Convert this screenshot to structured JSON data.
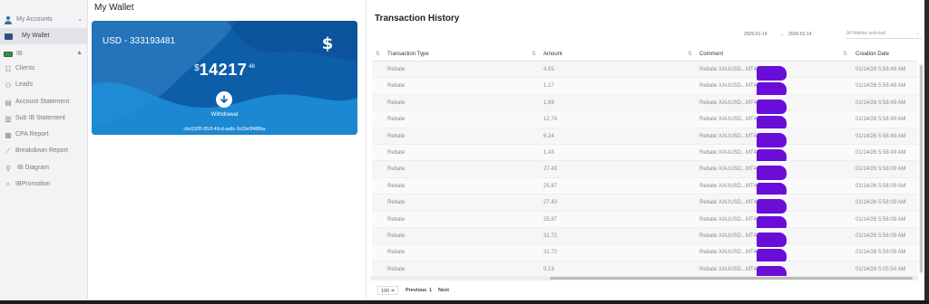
{
  "sidebar": {
    "items": [
      {
        "label": "My Accounts",
        "icon": "user-icon",
        "chev": "⌄"
      },
      {
        "label": "My Wallet",
        "icon": "wallet-icon"
      },
      {
        "label": "IB",
        "icon": "money-icon",
        "chev": "▲"
      },
      {
        "label": "Clients",
        "icon": "clients-icon"
      },
      {
        "label": "Leads",
        "icon": "leads-icon"
      },
      {
        "label": "Account Statement",
        "icon": "statement-icon"
      },
      {
        "label": "Sub IB Statement",
        "icon": "sub-ib-icon"
      },
      {
        "label": "CPA Report",
        "icon": "cpa-icon"
      },
      {
        "label": "Breakdown Report",
        "icon": "chart-icon"
      },
      {
        "label": "IB Diagram",
        "icon": "diagram-icon"
      },
      {
        "label": "IBPromotion",
        "icon": "promotion-icon"
      }
    ]
  },
  "main": {
    "title": "My Wallet"
  },
  "wallet": {
    "account": "USD - 333193481",
    "currency_symbol": "$",
    "balance_int": "14217",
    "balance_dec": "48",
    "withdraw_label": "Withdrawal",
    "wallet_id": "cbc032f5-852f-40cd-aa8c-3c03e0f488ba",
    "colors": {
      "primary": "#0d5ea8",
      "light": "#2a9ee0"
    }
  },
  "transactions": {
    "title": "Transaction History",
    "date_from": "2026-01-14",
    "date_to": "2026-01-14",
    "wallet_filter": "All Wallets selected",
    "columns": [
      "Transaction Type",
      "Amount",
      "Comment",
      "Creation Date"
    ],
    "rows": [
      {
        "type": "Rebate",
        "amount": "4.55",
        "comment": "Rebate XAUUSD...MT4",
        "date": "01/14/26 5:58:49 AM"
      },
      {
        "type": "Rebate",
        "amount": "1.17",
        "comment": "Rebate XAUUSD...MT4",
        "date": "01/14/26 5:58:49 AM"
      },
      {
        "type": "Rebate",
        "amount": "1.69",
        "comment": "Rebate XAUUSD...MT4",
        "date": "01/14/26 5:58:49 AM"
      },
      {
        "type": "Rebate",
        "amount": "12.74",
        "comment": "Rebate XAUUSD...MT4",
        "date": "01/14/26 5:58:49 AM"
      },
      {
        "type": "Rebate",
        "amount": "6.24",
        "comment": "Rebate XAUUSD...MT4",
        "date": "01/14/26 5:58:49 AM"
      },
      {
        "type": "Rebate",
        "amount": "1.43",
        "comment": "Rebate XAUUSD...MT4",
        "date": "01/14/26 5:58:49 AM"
      },
      {
        "type": "Rebate",
        "amount": "27.43",
        "comment": "Rebate XAUUSD...MT4",
        "date": "01/14/26 5:58:09 AM"
      },
      {
        "type": "Rebate",
        "amount": "25.87",
        "comment": "Rebate XAUUSD...MT4",
        "date": "01/14/26 5:58:09 AM"
      },
      {
        "type": "Rebate",
        "amount": "27.43",
        "comment": "Rebate XAUUSD...MT4 -",
        "date": "01/14/26 5:58:09 AM"
      },
      {
        "type": "Rebate",
        "amount": "25.87",
        "comment": "Rebate XAUUSD...MT4",
        "date": "01/14/26 5:58:09 AM"
      },
      {
        "type": "Rebate",
        "amount": "31.72",
        "comment": "Rebate XAUUSD...MT4",
        "date": "01/14/26 5:58:09 AM"
      },
      {
        "type": "Rebate",
        "amount": "31.72",
        "comment": "Rebate XAUUSD...MT4",
        "date": "01/14/26 5:58:09 AM"
      },
      {
        "type": "Rebate",
        "amount": "0.13",
        "comment": "Rebate XAUUSD...MT4",
        "date": "01/14/26 5:05:54 AM"
      }
    ],
    "redaction_color": "#6a0dd8"
  },
  "pager": {
    "page_size": "100 ≑",
    "previous": "Previous",
    "page": "1",
    "next": "Next"
  }
}
